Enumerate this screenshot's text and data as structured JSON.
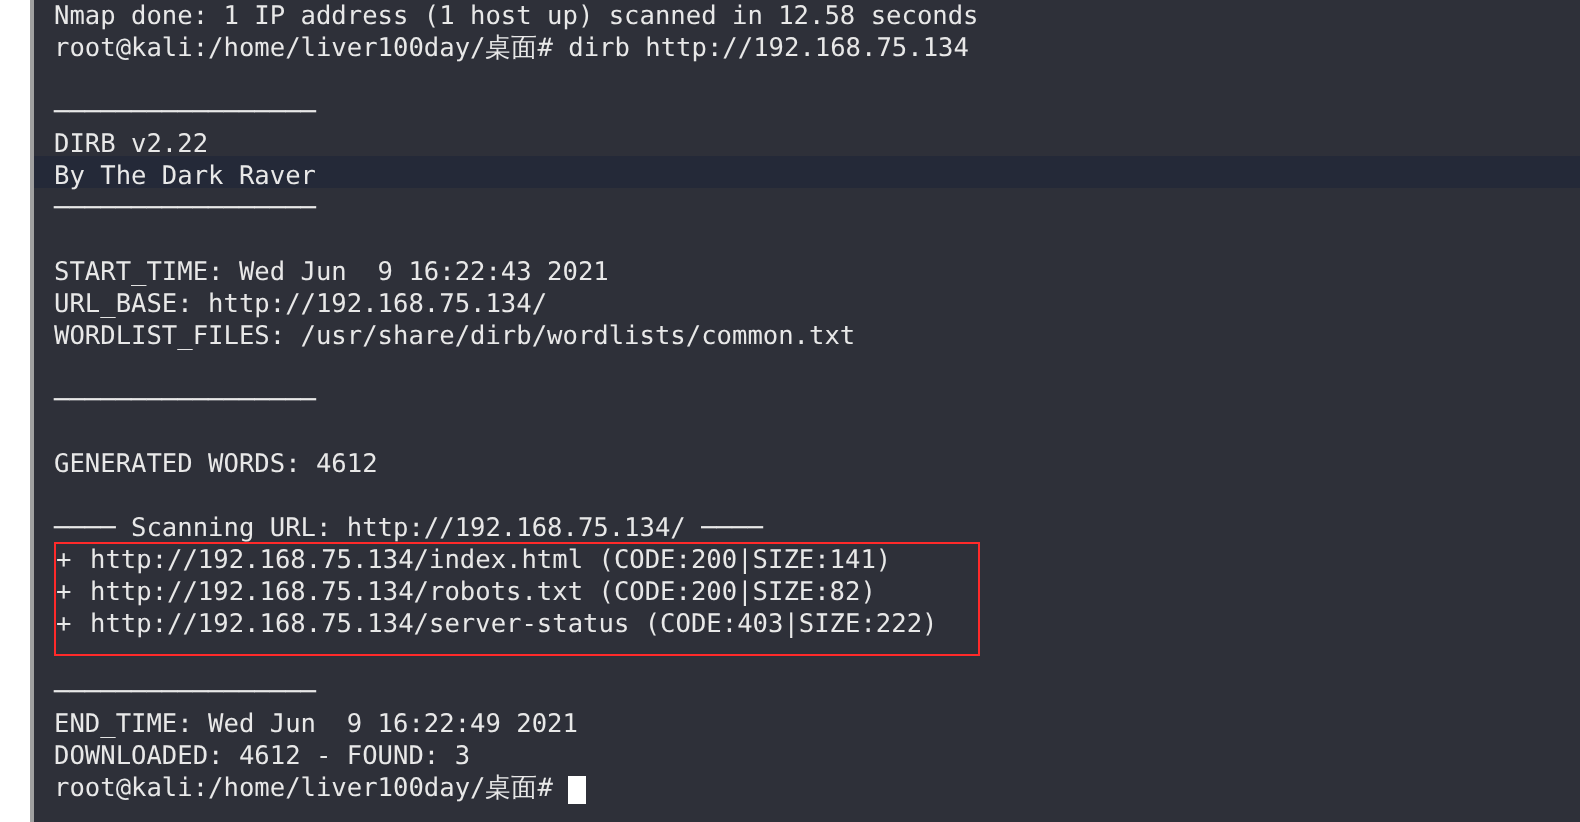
{
  "terminal": {
    "lines": [
      {
        "kind": "text",
        "text": "Nmap done: 1 IP address (1 host up) scanned in 12.58 seconds"
      },
      {
        "kind": "text",
        "text": "root@kali:/home/liver100day/桌面# dirb http://192.168.75.134"
      },
      {
        "kind": "blank"
      },
      {
        "kind": "rule",
        "text": "─────────────────"
      },
      {
        "kind": "text",
        "text": "DIRB v2.22"
      },
      {
        "kind": "text",
        "text": "By The Dark Raver"
      },
      {
        "kind": "rule",
        "text": "─────────────────"
      },
      {
        "kind": "blank"
      },
      {
        "kind": "text",
        "text": "START_TIME: Wed Jun  9 16:22:43 2021"
      },
      {
        "kind": "text",
        "text": "URL_BASE: http://192.168.75.134/"
      },
      {
        "kind": "text",
        "text": "WORDLIST_FILES: /usr/share/dirb/wordlists/common.txt"
      },
      {
        "kind": "blank"
      },
      {
        "kind": "rule",
        "text": "─────────────────"
      },
      {
        "kind": "blank"
      },
      {
        "kind": "text",
        "text": "GENERATED WORDS: 4612"
      },
      {
        "kind": "blank"
      },
      {
        "kind": "text",
        "text": "──── Scanning URL: http://192.168.75.134/ ────"
      },
      {
        "kind": "result",
        "prefix": "+",
        "text": "http://192.168.75.134/index.html (CODE:200|SIZE:141)",
        "highlighted": true
      },
      {
        "kind": "result",
        "prefix": "+",
        "text": "http://192.168.75.134/robots.txt (CODE:200|SIZE:82)",
        "highlighted": true
      },
      {
        "kind": "result",
        "prefix": "+",
        "text": "http://192.168.75.134/server-status (CODE:403|SIZE:222)",
        "highlighted": true
      },
      {
        "kind": "blank"
      },
      {
        "kind": "rule",
        "text": "─────────────────"
      },
      {
        "kind": "text",
        "text": "END_TIME: Wed Jun  9 16:22:49 2021"
      },
      {
        "kind": "text",
        "text": "DOWNLOADED: 4612 - FOUND: 3"
      },
      {
        "kind": "prompt",
        "text": "root@kali:/home/liver100day/桌面#",
        "cursor": true
      }
    ]
  }
}
